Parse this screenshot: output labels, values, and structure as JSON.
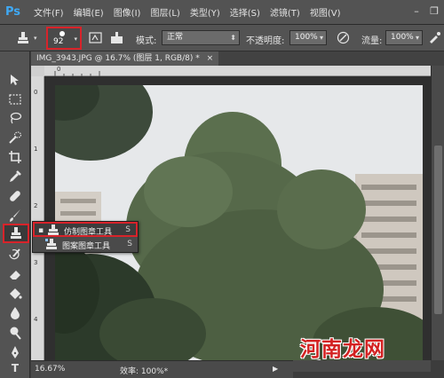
{
  "app": {
    "logo_text": "Ps"
  },
  "menubar": {
    "items": [
      "文件(F)",
      "编辑(E)",
      "图像(I)",
      "图层(L)",
      "类型(Y)",
      "选择(S)",
      "滤镜(T)",
      "视图(V)"
    ]
  },
  "window_controls": {
    "minimize": "–",
    "restore": "❐"
  },
  "options_bar": {
    "brush_size": "92",
    "mode_label": "模式:",
    "mode_value": "正常",
    "opacity_label": "不透明度:",
    "opacity_value": "100%",
    "flow_label": "流量:",
    "flow_value": "100%"
  },
  "document": {
    "tab_title": "IMG_3943.JPG @ 16.7% (图层 1, RGB/8) *",
    "tab_close": "×"
  },
  "rulers": {
    "horizontal": [
      "0"
    ],
    "vertical": [
      "0",
      "1",
      "2",
      "3",
      "4"
    ]
  },
  "status": {
    "zoom": "16.67%",
    "efficiency": "效率: 100%*",
    "arrow": "▶"
  },
  "flyout": {
    "items": [
      {
        "bullet": "▪",
        "label": "仿制图章工具",
        "shortcut": "S",
        "icon": "clone-stamp-icon"
      },
      {
        "bullet": "",
        "label": "图案图章工具",
        "shortcut": "S",
        "icon": "pattern-stamp-icon"
      }
    ]
  },
  "toolbar": {
    "text_tool_label": "T",
    "tools": [
      "move-icon",
      "marquee-icon",
      "lasso-icon",
      "quick-select-icon",
      "crop-icon",
      "eyedropper-icon",
      "healing-brush-icon",
      "brush-icon",
      "clone-stamp-icon",
      "history-brush-icon",
      "eraser-icon",
      "paint-bucket-icon",
      "blur-icon",
      "dodge-icon",
      "pen-icon",
      "type-icon"
    ]
  },
  "watermark": {
    "text": "河南龙网"
  },
  "colors": {
    "highlight_red": "#d8232a",
    "ps_blue": "#3fa9f5",
    "ui_gray": "#535353"
  }
}
